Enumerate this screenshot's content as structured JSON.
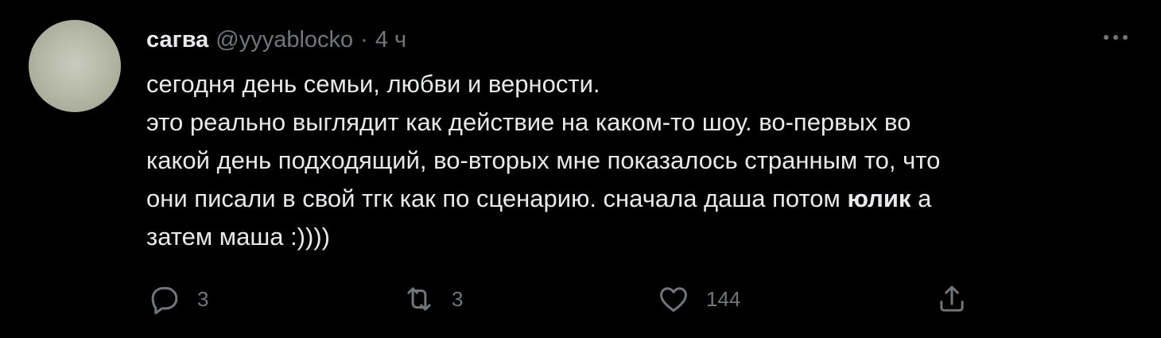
{
  "author": {
    "name": "сагва",
    "handle": "@yyyablocko",
    "separator": "·",
    "time": "4 ч"
  },
  "tweet": {
    "line1": "сегодня день семьи, любви и верности.",
    "line2": "это реально выглядит как действие на каком-то шоу. во-первых во",
    "line3": "какой день подходящий, во-вторых мне показалось странным то, что",
    "line4_start": "они писали в свой тгк как по сценарию. сначала даша потом ",
    "line4_bold": "юлик",
    "line4_end": " а",
    "line5": "затем маша :))))"
  },
  "actions": {
    "reply_count": "3",
    "retweet_count": "3",
    "like_count": "144"
  },
  "icons": {
    "more": "more-horizontal-icon",
    "reply": "reply-icon",
    "retweet": "retweet-icon",
    "like": "heart-icon",
    "share": "share-icon"
  },
  "colors": {
    "background": "#000000",
    "text": "#e7e9ea",
    "secondary": "#71767b"
  }
}
